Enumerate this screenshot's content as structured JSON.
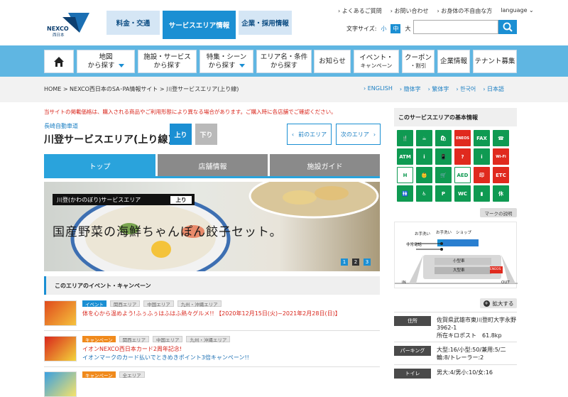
{
  "header": {
    "logo_text": "NEXCO",
    "logo_sub": "西日本",
    "tabs": [
      "料金・交通",
      "サービスエリア情報",
      "企業・採用情報"
    ],
    "util_links": [
      "よくあるご質問",
      "お問い合わせ",
      "お身体の不自由な方",
      "language"
    ],
    "font_size_label": "文字サイズ:",
    "font_sizes": [
      "小",
      "中",
      "大"
    ],
    "search_placeholder": ""
  },
  "nav": {
    "home_icon": "home-icon",
    "items": [
      {
        "l1": "地図",
        "l2": "から探す",
        "caret": true
      },
      {
        "l1": "施設・サービス",
        "l2": "から探す",
        "caret": false
      },
      {
        "l1": "特集・シーン",
        "l2": "から探す",
        "caret": true
      },
      {
        "l1": "エリア名・条件",
        "l2": "から探す",
        "caret": false
      },
      {
        "l1": "お知らせ",
        "l2": "",
        "caret": false
      },
      {
        "l1": "イベント・",
        "l2": "キャンペーン",
        "caret": false
      },
      {
        "l1": "クーポン",
        "l2": "・割引",
        "caret": false
      },
      {
        "l1": "企業情報",
        "l2": "",
        "caret": false
      },
      {
        "l1": "テナント募集",
        "l2": "",
        "caret": false
      }
    ]
  },
  "breadcrumb": "HOME > NEXCO西日本のSA･PA情報サイト > 川登サービスエリア(上り線)",
  "languages": [
    "ENGLISH",
    "簡体字",
    "繁体字",
    "한국어",
    "日本語"
  ],
  "notice": "当サイトの掲載価格は、購入される商品やご利用形態により異なる場合があります。ご購入時に各店舗でご確認ください。",
  "road": "長崎自動車道",
  "sa_name": "川登サービスエリア(上り線)",
  "direction": {
    "up": "上り",
    "down": "下り"
  },
  "area_nav": {
    "prev": "前のエリア",
    "next": "次のエリア"
  },
  "tabs": [
    "トップ",
    "店舗情報",
    "施設ガイド"
  ],
  "hero": {
    "label": "川登(かわのぼり)サービスエリア",
    "tag": "上り",
    "title": "国産野菜の海鮮ちゃんぽん餃子セット。",
    "dots": [
      "1",
      "2",
      "3"
    ]
  },
  "events_heading": "このエリアのイベント・キャンペーン",
  "events": [
    {
      "type": "イベント",
      "type_class": "ev",
      "areas": [
        "関西エリア",
        "中国エリア",
        "九州・沖縄エリア"
      ],
      "title": "体を心から温めよう!ふぅふぅはふはふ熱々グルメ!! 【2020年12月15日(火)~2021年2月28日(日)】",
      "title2": ""
    },
    {
      "type": "キャンペーン",
      "type_class": "cp",
      "areas": [
        "関西エリア",
        "中国エリア",
        "九州・沖縄エリア"
      ],
      "title": "イオンNEXCO西日本カード2周年記念!",
      "title2": "イオンマークのカード払いでときめきポイント3倍キャンペーン!!"
    },
    {
      "type": "キャンペーン",
      "type_class": "cp",
      "areas": [
        "全エリア"
      ],
      "title": "",
      "title2": ""
    }
  ],
  "sidebar": {
    "heading": "このサービスエリアの基本情報",
    "facility_icons": [
      {
        "name": "restaurant-icon",
        "label": "🍴",
        "style": ""
      },
      {
        "name": "snack-icon",
        "label": "☕",
        "style": ""
      },
      {
        "name": "shop-icon",
        "label": "🛍",
        "style": ""
      },
      {
        "name": "eneos-icon",
        "label": "ENEOS",
        "style": "red"
      },
      {
        "name": "fax-icon",
        "label": "FAX",
        "style": ""
      },
      {
        "name": "phone-icon",
        "label": "☎",
        "style": ""
      },
      {
        "name": "atm-icon",
        "label": "ATM",
        "style": ""
      },
      {
        "name": "highway-info-icon",
        "label": "i",
        "style": ""
      },
      {
        "name": "mobile-icon",
        "label": "📱",
        "style": ""
      },
      {
        "name": "question-icon",
        "label": "?",
        "style": "red"
      },
      {
        "name": "info-icon",
        "label": "i",
        "style": ""
      },
      {
        "name": "wifi-icon",
        "label": "Wi-Fi",
        "style": "red"
      },
      {
        "name": "hiway-icon",
        "label": "H",
        "style": "wh"
      },
      {
        "name": "baby-icon",
        "label": "👶",
        "style": ""
      },
      {
        "name": "cart-icon",
        "label": "🛒",
        "style": ""
      },
      {
        "name": "aed-icon",
        "label": "AED",
        "style": "wh"
      },
      {
        "name": "stamp-icon",
        "label": "印",
        "style": "red"
      },
      {
        "name": "etc-icon",
        "label": "ETC",
        "style": "red"
      },
      {
        "name": "toilet-icon",
        "label": "🚻",
        "style": ""
      },
      {
        "name": "nursing-icon",
        "label": "♿",
        "style": ""
      },
      {
        "name": "accessible-parking-icon",
        "label": "P",
        "style": ""
      },
      {
        "name": "accessible-toilet-icon",
        "label": "WC",
        "style": ""
      },
      {
        "name": "shower-icon",
        "label": "▮",
        "style": ""
      },
      {
        "name": "rest-icon",
        "label": "休",
        "style": ""
      }
    ],
    "mark_button": "マークの説明",
    "map": {
      "labels": [
        "お手洗い",
        "お手洗い",
        "ショップ",
        "非常電話",
        "小型車",
        "大型車",
        "ENEOS",
        "IN",
        "OUT"
      ]
    },
    "zoom_button": "拡大する",
    "info": [
      {
        "label": "住所",
        "lines": [
          "佐賀県武雄市東川登町大字永野",
          "3962-1",
          "所在キロポスト　61.8kp"
        ]
      },
      {
        "label": "パーキング",
        "lines": [
          "大型:16/小型:50/兼用:5/二",
          "輪:8/トレーラー:2"
        ]
      },
      {
        "label": "トイレ",
        "lines": [
          "男大:4/男小:10/女:16"
        ]
      }
    ]
  },
  "colors": {
    "accent": "#1b8fd3",
    "nav_bg": "#5fb6e2",
    "alert": "#d9261c",
    "facility_green": "#0f9a52"
  }
}
